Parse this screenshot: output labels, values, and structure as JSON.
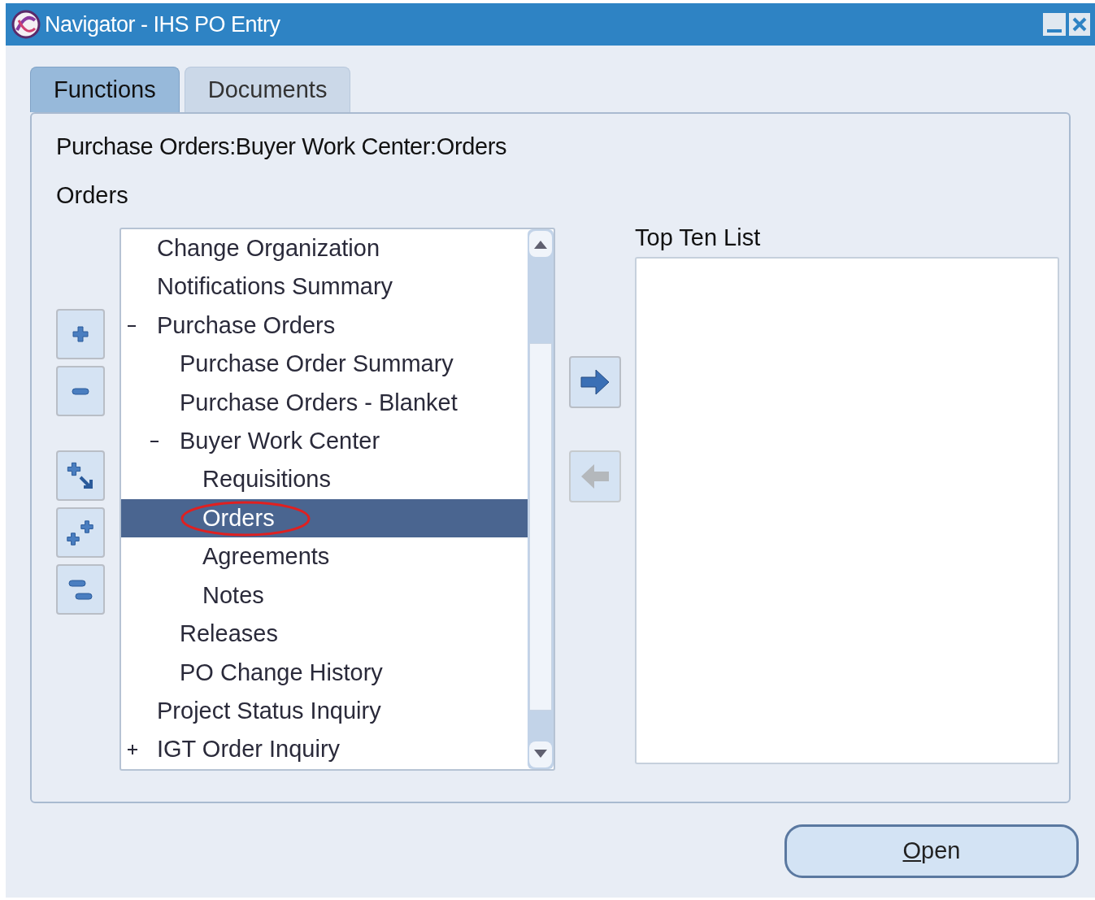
{
  "window": {
    "title": "Navigator - IHS PO Entry"
  },
  "tabs": [
    {
      "label": "Functions",
      "selected": true
    },
    {
      "label": "Documents",
      "selected": false
    }
  ],
  "breadcrumb": "Purchase Orders:Buyer Work Center:Orders",
  "current": "Orders",
  "tree": [
    {
      "label": "Change Organization",
      "selected": false
    },
    {
      "label": "Notifications Summary",
      "selected": false
    },
    {
      "label": "Purchase Orders",
      "selected": false,
      "expanded": true,
      "children": [
        {
          "label": "Purchase Order Summary",
          "selected": false
        },
        {
          "label": "Purchase Orders - Blanket",
          "selected": false
        },
        {
          "label": "Buyer Work Center",
          "selected": false,
          "expanded": true,
          "children": [
            {
              "label": "Requisitions",
              "selected": false
            },
            {
              "label": "Orders",
              "selected": true,
              "circled": true
            },
            {
              "label": "Agreements",
              "selected": false
            },
            {
              "label": "Notes",
              "selected": false
            }
          ]
        },
        {
          "label": "Releases",
          "selected": false
        },
        {
          "label": "PO Change History",
          "selected": false
        }
      ]
    },
    {
      "label": "Project Status Inquiry",
      "selected": false
    },
    {
      "label": "IGT Order Inquiry",
      "selected": false,
      "expanded": false
    }
  ],
  "top_ten": {
    "label": "Top Ten List"
  },
  "buttons": [
    {
      "label": "Open"
    }
  ]
}
